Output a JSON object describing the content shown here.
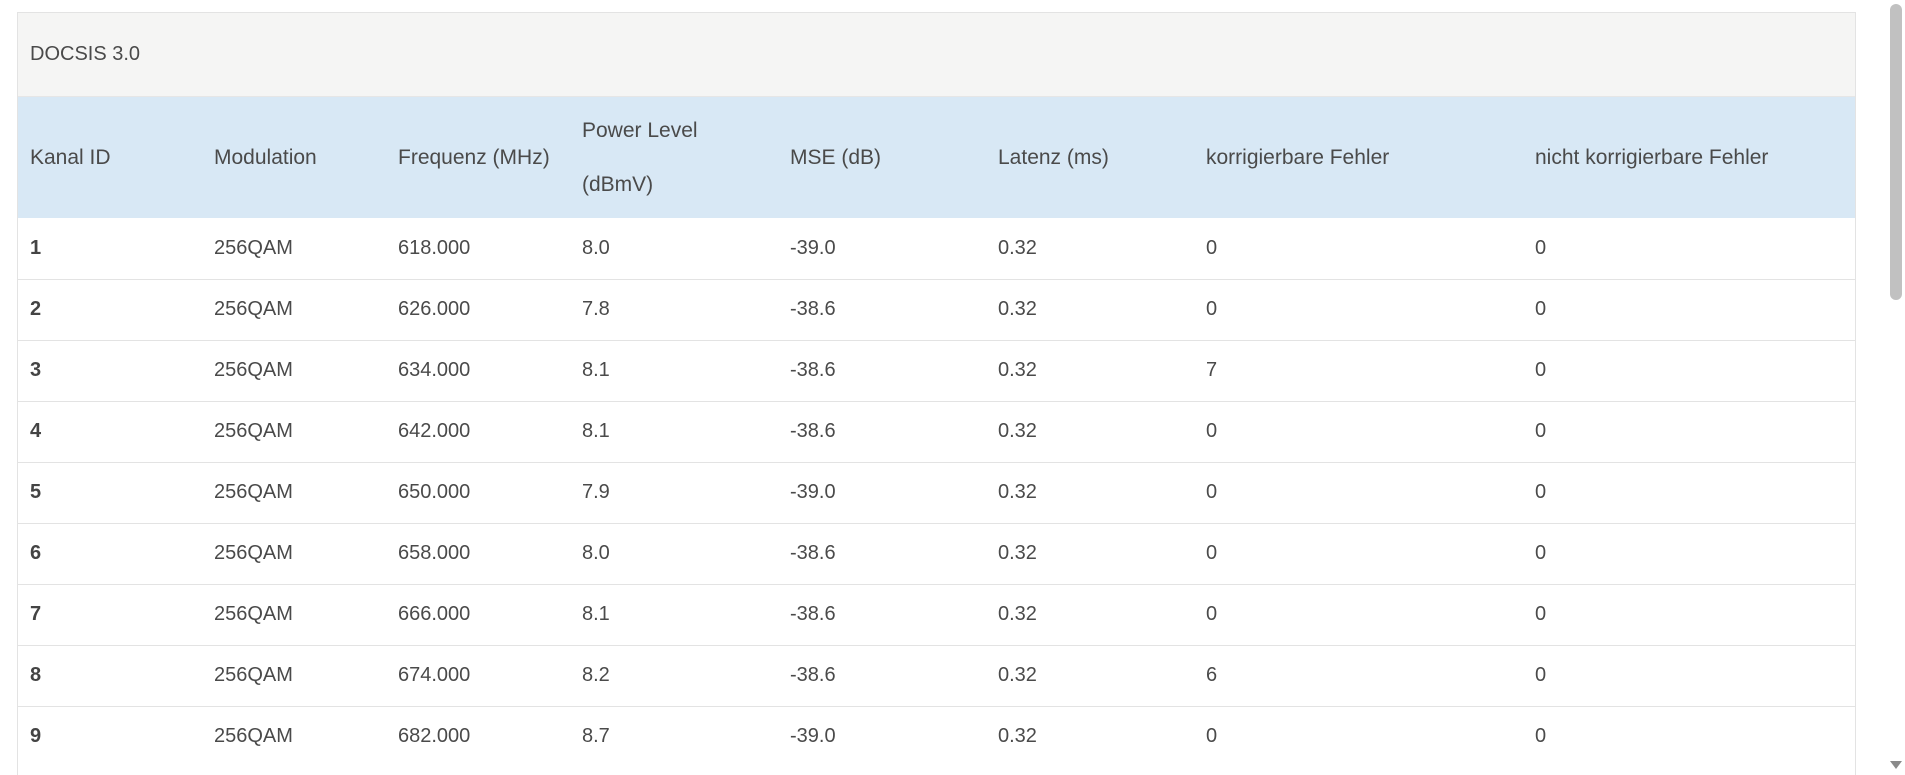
{
  "panel": {
    "title": "DOCSIS 3.0"
  },
  "table": {
    "headers": {
      "kanal_id": "Kanal ID",
      "modulation": "Modulation",
      "frequenz": "Frequenz (MHz)",
      "power_level_line1": "Power Level",
      "power_level_line2": "(dBmV)",
      "mse": "MSE (dB)",
      "latenz": "Latenz (ms)",
      "korrigierbar": "korrigierbare Fehler",
      "nicht_korrigierbar": "nicht korrigierbare Fehler"
    },
    "rows": [
      {
        "id": "1",
        "modulation": "256QAM",
        "freq": "618.000",
        "power": "8.0",
        "mse": "-39.0",
        "latenz": "0.32",
        "korr": "0",
        "nkorr": "0"
      },
      {
        "id": "2",
        "modulation": "256QAM",
        "freq": "626.000",
        "power": "7.8",
        "mse": "-38.6",
        "latenz": "0.32",
        "korr": "0",
        "nkorr": "0"
      },
      {
        "id": "3",
        "modulation": "256QAM",
        "freq": "634.000",
        "power": "8.1",
        "mse": "-38.6",
        "latenz": "0.32",
        "korr": "7",
        "nkorr": "0"
      },
      {
        "id": "4",
        "modulation": "256QAM",
        "freq": "642.000",
        "power": "8.1",
        "mse": "-38.6",
        "latenz": "0.32",
        "korr": "0",
        "nkorr": "0"
      },
      {
        "id": "5",
        "modulation": "256QAM",
        "freq": "650.000",
        "power": "7.9",
        "mse": "-39.0",
        "latenz": "0.32",
        "korr": "0",
        "nkorr": "0"
      },
      {
        "id": "6",
        "modulation": "256QAM",
        "freq": "658.000",
        "power": "8.0",
        "mse": "-38.6",
        "latenz": "0.32",
        "korr": "0",
        "nkorr": "0"
      },
      {
        "id": "7",
        "modulation": "256QAM",
        "freq": "666.000",
        "power": "8.1",
        "mse": "-38.6",
        "latenz": "0.32",
        "korr": "0",
        "nkorr": "0"
      },
      {
        "id": "8",
        "modulation": "256QAM",
        "freq": "674.000",
        "power": "8.2",
        "mse": "-38.6",
        "latenz": "0.32",
        "korr": "6",
        "nkorr": "0"
      },
      {
        "id": "9",
        "modulation": "256QAM",
        "freq": "682.000",
        "power": "8.7",
        "mse": "-39.0",
        "latenz": "0.32",
        "korr": "0",
        "nkorr": "0"
      }
    ]
  },
  "scrollbar": {
    "down_arrow_icon": "chevron-down-icon"
  },
  "colors": {
    "header_bg": "#d8e8f5",
    "panel_head_bg": "#f5f5f4",
    "text": "#4a4a4a"
  }
}
